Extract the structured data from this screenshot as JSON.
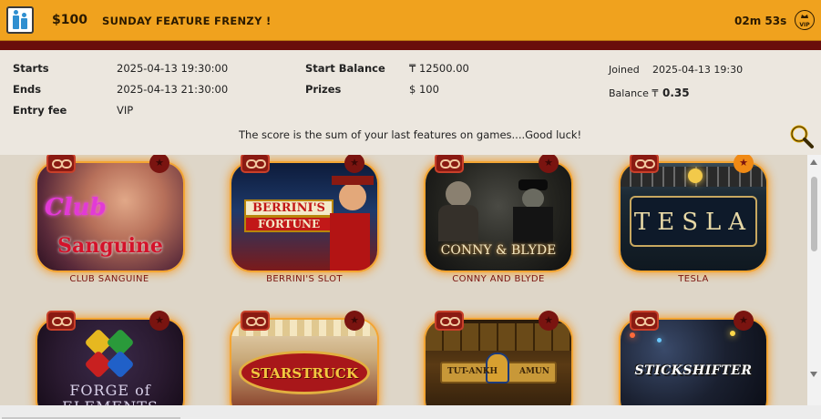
{
  "header": {
    "prize": "$100",
    "title": "SUNDAY FEATURE FRENZY !",
    "countdown": "02m 53s",
    "vip_badge": "VIP",
    "icons": [
      "app-logo-icon",
      "vip-icon"
    ]
  },
  "details": {
    "starts_label": "Starts",
    "starts_value": "2025-04-13 19:30:00",
    "ends_label": "Ends",
    "ends_value": "2025-04-13 21:30:00",
    "entry_label": "Entry fee",
    "entry_value": "VIP",
    "start_balance_label": "Start Balance",
    "start_balance_value": "₸ 12500.00",
    "prizes_label": "Prizes",
    "prizes_value": "$ 100",
    "joined_label": "Joined",
    "joined_value": "2025-04-13 19:30",
    "balance_label": "Balance ₸",
    "balance_value": "0.35"
  },
  "description": "The score is the sum of your last features on games....Good luck!",
  "games": [
    {
      "caption": "CLUB SANGUINE",
      "art_line1": "Club",
      "art_line2": "Sanguine",
      "favorite": false
    },
    {
      "caption": "BERRINI'S SLOT",
      "art_line1": "BERRINI'S",
      "art_line2": "FORTUNE",
      "favorite": false
    },
    {
      "caption": "CONNY AND BLYDE",
      "art_line1": "CONNY & BLYDE",
      "art_line2": "",
      "favorite": false
    },
    {
      "caption": "TESLA",
      "art_line1": "TESLA",
      "art_line2": "",
      "favorite": true
    },
    {
      "caption": "",
      "art_line1": "FORGE of",
      "art_line2": "ELEMENTS",
      "favorite": false
    },
    {
      "caption": "",
      "art_line1": "STARSTRUCK",
      "art_line2": "",
      "favorite": false
    },
    {
      "caption": "",
      "art_line1": "TUT-ANKH",
      "art_line2": "AMUN",
      "favorite": false
    },
    {
      "caption": "",
      "art_line1": "STICKSHIFTER",
      "art_line2": "",
      "favorite": false
    }
  ],
  "colors": {
    "header_bg": "#f0a21e",
    "band": "#6a0d0b",
    "caption": "#7a1410",
    "tile_glow": "#f3a533"
  }
}
